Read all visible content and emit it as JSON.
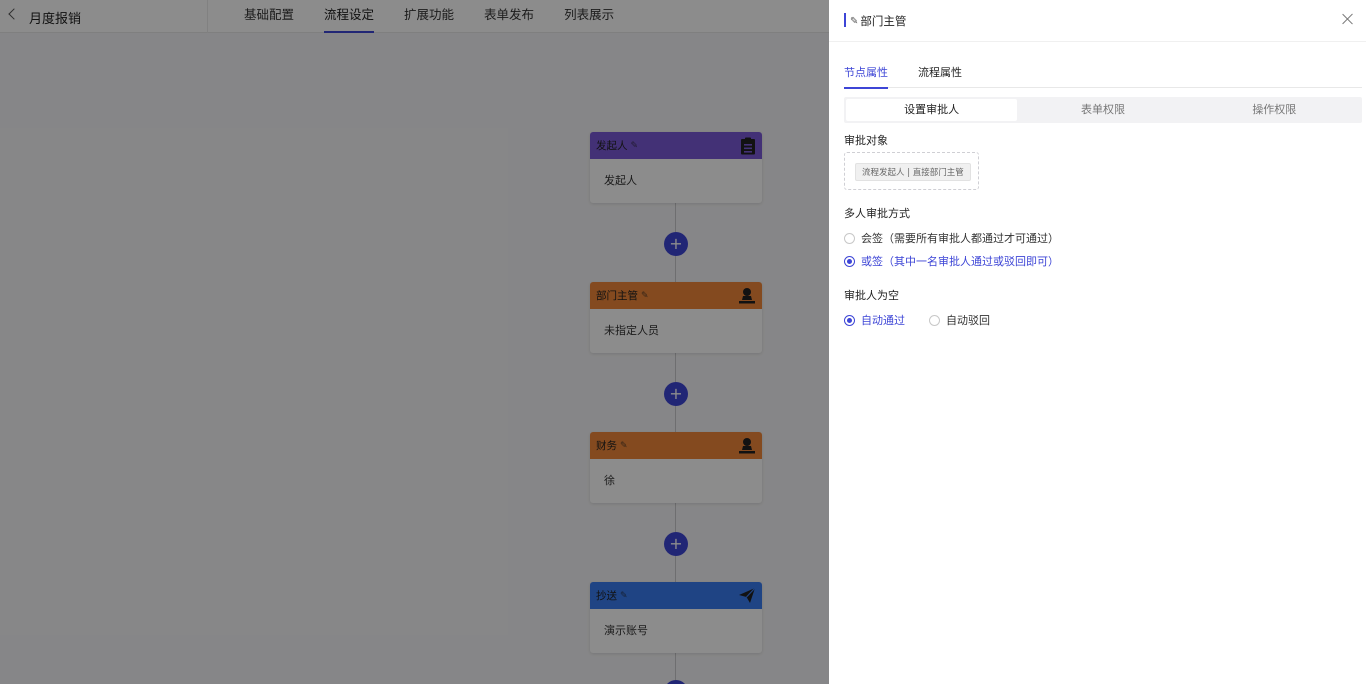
{
  "header": {
    "back_label": "",
    "title": "月度报销",
    "tabs": [
      {
        "label": "基础配置"
      },
      {
        "label": "流程设定",
        "active": true
      },
      {
        "label": "扩展功能"
      },
      {
        "label": "表单发布"
      },
      {
        "label": "列表展示"
      }
    ]
  },
  "flow": {
    "nodes": [
      {
        "title": "发起人",
        "body": "发起人",
        "color": "#7b59d8",
        "icon": "clipboard-icon"
      },
      {
        "title": "部门主管",
        "body": "未指定人员",
        "color": "#f0883a",
        "icon": "approver-icon"
      },
      {
        "title": "财务",
        "body": "徐",
        "color": "#f0883a",
        "icon": "approver-icon"
      },
      {
        "title": "抄送",
        "body": "演示账号",
        "color": "#3a7cf0",
        "icon": "send-icon"
      }
    ],
    "add_symbol": "+"
  },
  "drawer": {
    "title": "部门主管",
    "tabs": [
      {
        "label": "节点属性",
        "active": true
      },
      {
        "label": "流程属性"
      }
    ],
    "segments": [
      {
        "label": "设置审批人",
        "active": true
      },
      {
        "label": "表单权限"
      },
      {
        "label": "操作权限"
      }
    ],
    "approver_section": {
      "label": "审批对象",
      "tag": "流程发起人 | 直接部门主管"
    },
    "multi_section": {
      "label": "多人审批方式",
      "options": [
        {
          "label": "会签（需要所有审批人都通过才可通过）",
          "checked": false
        },
        {
          "label": "或签（其中一名审批人通过或驳回即可）",
          "checked": true
        }
      ]
    },
    "empty_section": {
      "label": "审批人为空",
      "options": [
        {
          "label": "自动通过",
          "checked": true
        },
        {
          "label": "自动驳回",
          "checked": false
        }
      ]
    }
  },
  "colors": {
    "accent": "#3d45d6",
    "overlay": "rgba(0,0,0,0.45)"
  }
}
